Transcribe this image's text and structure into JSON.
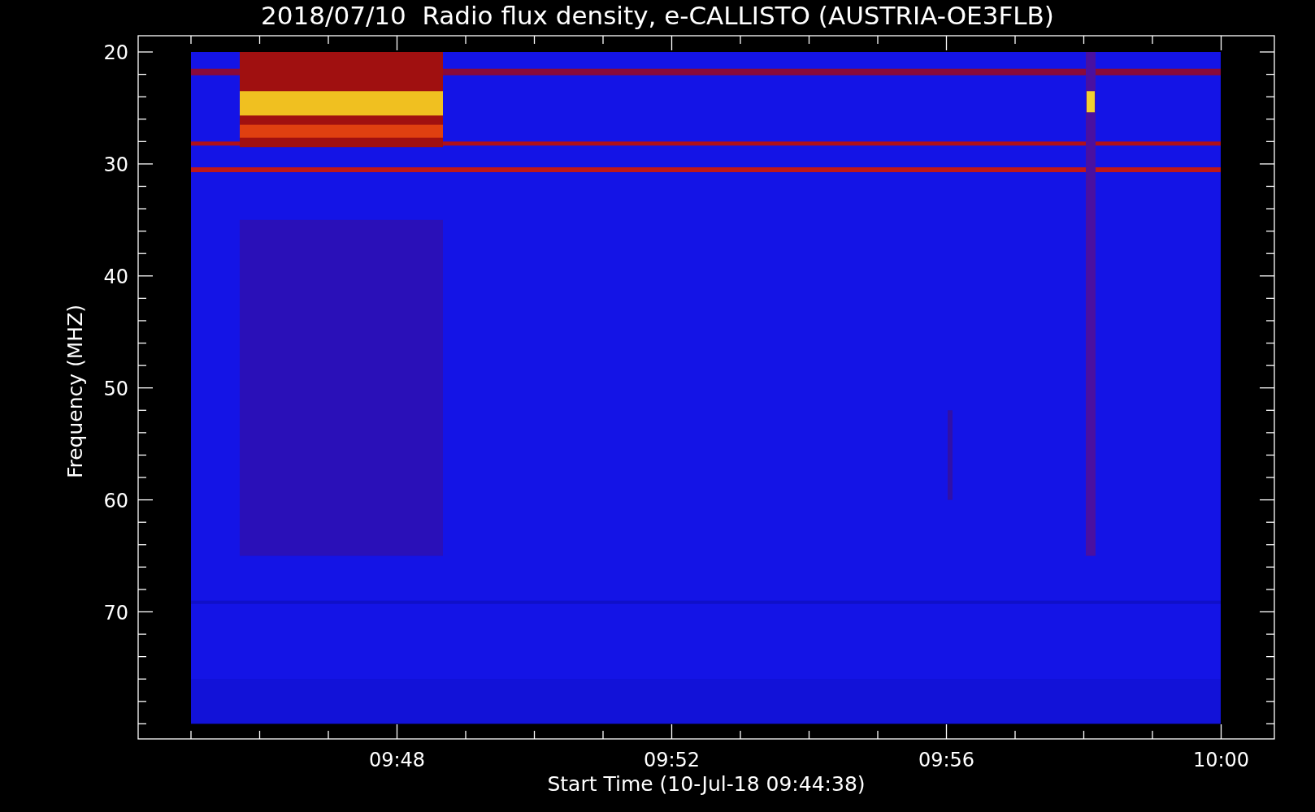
{
  "plot": {
    "title": "2018/07/10  Radio flux density, e-CALLISTO (AUSTRIA-OE3FLB)",
    "ylabel": "Frequency (MHZ)",
    "xlabel": "Start Time (10-Jul-18 09:44:38)",
    "xticks": [
      "09:48",
      "09:52",
      "09:56",
      "10:00"
    ],
    "yticks": [
      "20",
      "30",
      "40",
      "50",
      "60",
      "70"
    ]
  }
}
